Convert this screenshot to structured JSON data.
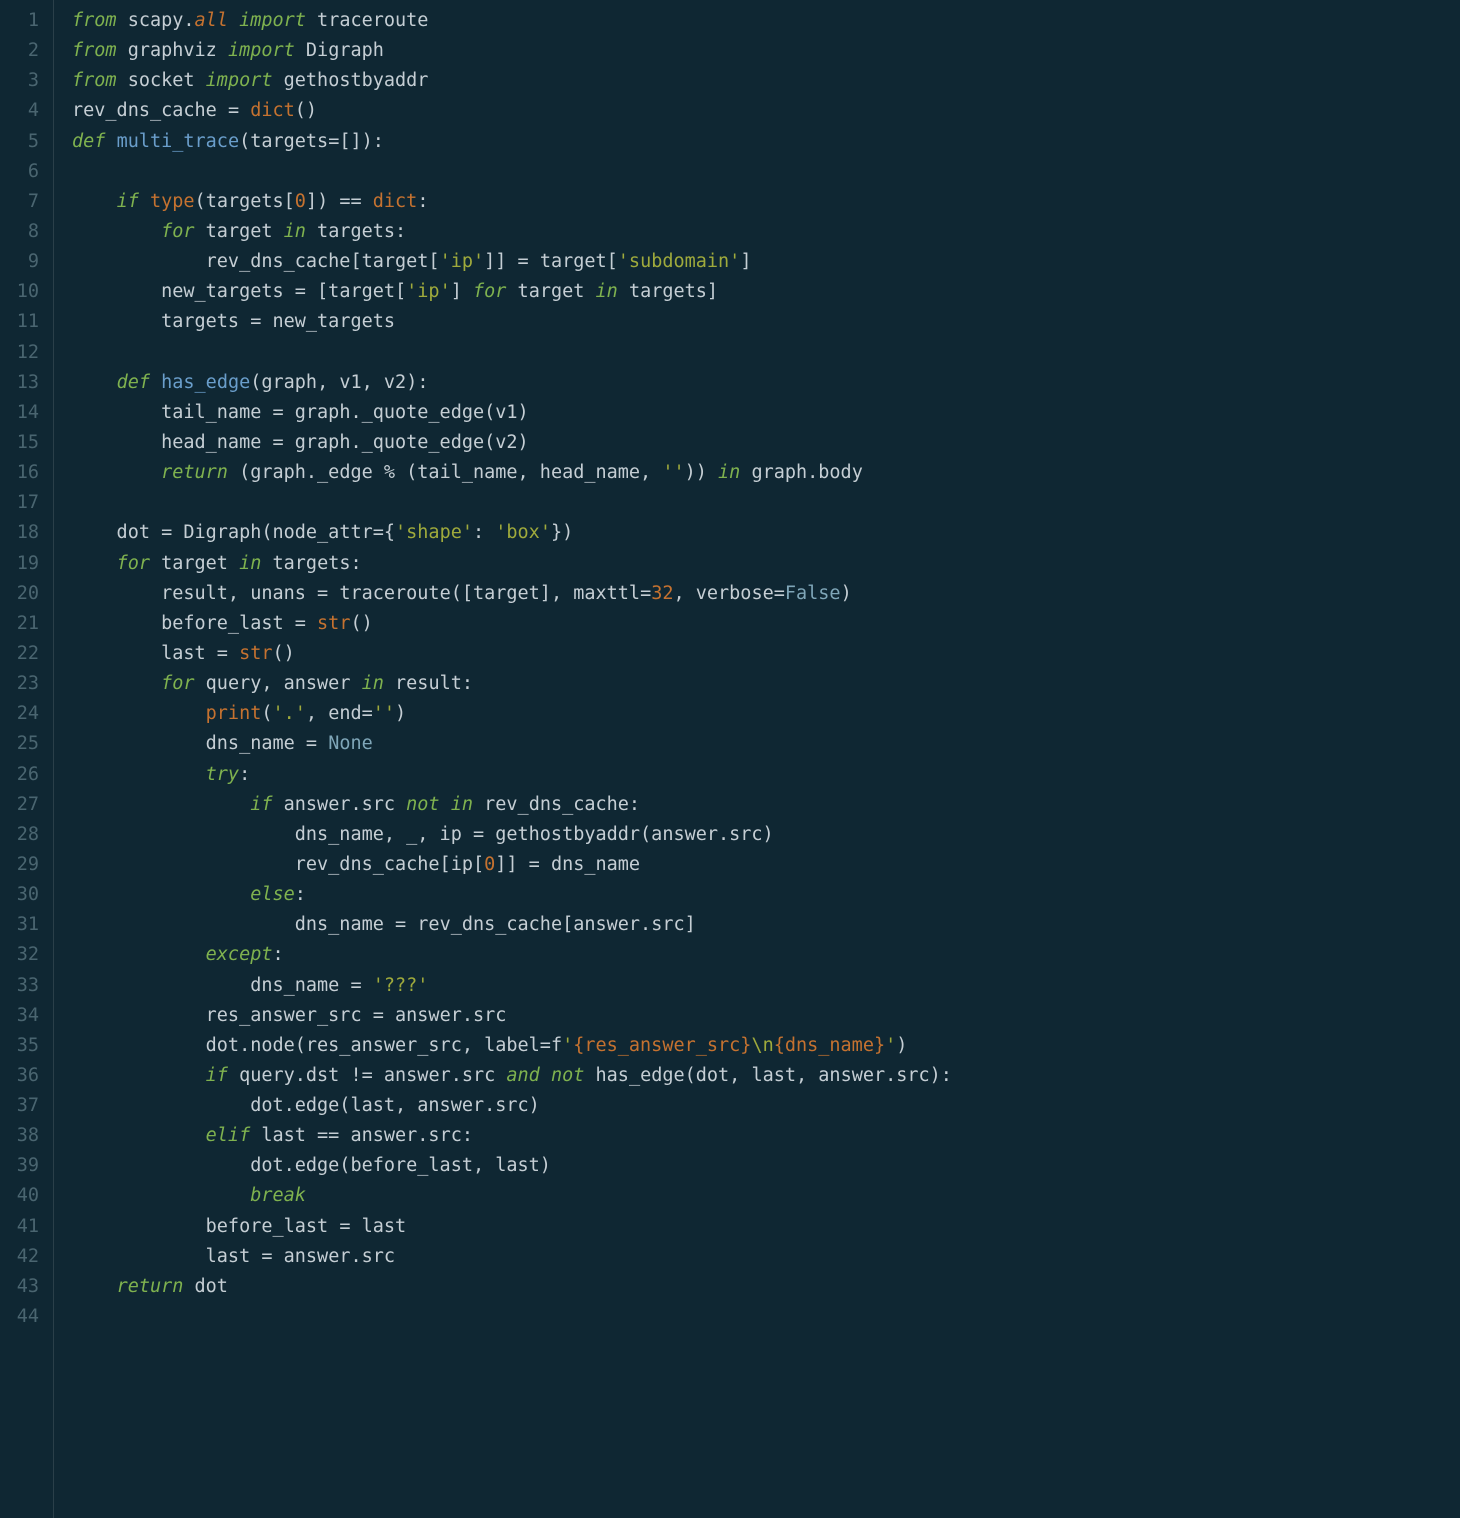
{
  "lineCount": 44,
  "code": {
    "l1": [
      [
        "kw",
        "from"
      ],
      [
        "id",
        " scapy"
      ],
      [
        "op",
        "."
      ],
      [
        "kw2",
        "all"
      ],
      [
        "id",
        " "
      ],
      [
        "kw",
        "import"
      ],
      [
        "id",
        " traceroute"
      ]
    ],
    "l2": [
      [
        "kw",
        "from"
      ],
      [
        "id",
        " graphviz "
      ],
      [
        "kw",
        "import"
      ],
      [
        "id",
        " Digraph"
      ]
    ],
    "l3": [
      [
        "kw",
        "from"
      ],
      [
        "id",
        " socket "
      ],
      [
        "kw",
        "import"
      ],
      [
        "id",
        " gethostbyaddr"
      ]
    ],
    "l4": [
      [
        "id",
        "rev_dns_cache "
      ],
      [
        "op",
        "="
      ],
      [
        "id",
        " "
      ],
      [
        "bi",
        "dict"
      ],
      [
        "op",
        "()"
      ]
    ],
    "l5": [
      [
        "kw",
        "def"
      ],
      [
        "id",
        " "
      ],
      [
        "def",
        "multi_trace"
      ],
      [
        "op",
        "("
      ],
      [
        "id",
        "targets"
      ],
      [
        "op",
        "=[]):"
      ]
    ],
    "l6": [],
    "l7": [
      [
        "id",
        "    "
      ],
      [
        "kw",
        "if"
      ],
      [
        "id",
        " "
      ],
      [
        "bi",
        "type"
      ],
      [
        "op",
        "("
      ],
      [
        "id",
        "targets"
      ],
      [
        "op",
        "["
      ],
      [
        "num",
        "0"
      ],
      [
        "op",
        "]) == "
      ],
      [
        "bi",
        "dict"
      ],
      [
        "op",
        ":"
      ]
    ],
    "l8": [
      [
        "id",
        "        "
      ],
      [
        "kw",
        "for"
      ],
      [
        "id",
        " target "
      ],
      [
        "kw",
        "in"
      ],
      [
        "id",
        " targets:"
      ]
    ],
    "l9": [
      [
        "id",
        "            rev_dns_cache[target["
      ],
      [
        "str",
        "'ip'"
      ],
      [
        "id",
        "]] "
      ],
      [
        "op",
        "="
      ],
      [
        "id",
        " target["
      ],
      [
        "str",
        "'subdomain'"
      ],
      [
        "id",
        "]"
      ]
    ],
    "l10": [
      [
        "id",
        "        new_targets "
      ],
      [
        "op",
        "="
      ],
      [
        "id",
        " [target["
      ],
      [
        "str",
        "'ip'"
      ],
      [
        "id",
        "] "
      ],
      [
        "kw",
        "for"
      ],
      [
        "id",
        " target "
      ],
      [
        "kw",
        "in"
      ],
      [
        "id",
        " targets]"
      ]
    ],
    "l11": [
      [
        "id",
        "        targets "
      ],
      [
        "op",
        "="
      ],
      [
        "id",
        " new_targets"
      ]
    ],
    "l12": [],
    "l13": [
      [
        "id",
        "    "
      ],
      [
        "kw",
        "def"
      ],
      [
        "id",
        " "
      ],
      [
        "def",
        "has_edge"
      ],
      [
        "op",
        "("
      ],
      [
        "id",
        "graph"
      ],
      [
        "op",
        ", "
      ],
      [
        "id",
        "v1"
      ],
      [
        "op",
        ", "
      ],
      [
        "id",
        "v2"
      ],
      [
        "op",
        "):"
      ]
    ],
    "l14": [
      [
        "id",
        "        tail_name "
      ],
      [
        "op",
        "="
      ],
      [
        "id",
        " graph._quote_edge(v1)"
      ]
    ],
    "l15": [
      [
        "id",
        "        head_name "
      ],
      [
        "op",
        "="
      ],
      [
        "id",
        " graph._quote_edge(v2)"
      ]
    ],
    "l16": [
      [
        "id",
        "        "
      ],
      [
        "kw",
        "return"
      ],
      [
        "id",
        " (graph._edge "
      ],
      [
        "op",
        "%"
      ],
      [
        "id",
        " (tail_name, head_name, "
      ],
      [
        "str",
        "''"
      ],
      [
        "id",
        ")) "
      ],
      [
        "kw",
        "in"
      ],
      [
        "id",
        " graph.body"
      ]
    ],
    "l17": [],
    "l18": [
      [
        "id",
        "    dot "
      ],
      [
        "op",
        "="
      ],
      [
        "id",
        " Digraph(node_attr"
      ],
      [
        "op",
        "="
      ],
      [
        "id",
        "{"
      ],
      [
        "str",
        "'shape'"
      ],
      [
        "op",
        ": "
      ],
      [
        "str",
        "'box'"
      ],
      [
        "id",
        "})"
      ]
    ],
    "l19": [
      [
        "id",
        "    "
      ],
      [
        "kw",
        "for"
      ],
      [
        "id",
        " target "
      ],
      [
        "kw",
        "in"
      ],
      [
        "id",
        " targets:"
      ]
    ],
    "l20": [
      [
        "id",
        "        result, unans "
      ],
      [
        "op",
        "="
      ],
      [
        "id",
        " traceroute([target], maxttl"
      ],
      [
        "op",
        "="
      ],
      [
        "num",
        "32"
      ],
      [
        "id",
        ", verbose"
      ],
      [
        "op",
        "="
      ],
      [
        "c1",
        "False"
      ],
      [
        "id",
        ")"
      ]
    ],
    "l21": [
      [
        "id",
        "        before_last "
      ],
      [
        "op",
        "="
      ],
      [
        "id",
        " "
      ],
      [
        "bi",
        "str"
      ],
      [
        "op",
        "()"
      ]
    ],
    "l22": [
      [
        "id",
        "        last "
      ],
      [
        "op",
        "="
      ],
      [
        "id",
        " "
      ],
      [
        "bi",
        "str"
      ],
      [
        "op",
        "()"
      ]
    ],
    "l23": [
      [
        "id",
        "        "
      ],
      [
        "kw",
        "for"
      ],
      [
        "id",
        " query, answer "
      ],
      [
        "kw",
        "in"
      ],
      [
        "id",
        " result:"
      ]
    ],
    "l24": [
      [
        "id",
        "            "
      ],
      [
        "bi",
        "print"
      ],
      [
        "op",
        "("
      ],
      [
        "str",
        "'.'"
      ],
      [
        "op",
        ", "
      ],
      [
        "id",
        "end"
      ],
      [
        "op",
        "="
      ],
      [
        "str",
        "''"
      ],
      [
        "op",
        ")"
      ]
    ],
    "l25": [
      [
        "id",
        "            dns_name "
      ],
      [
        "op",
        "="
      ],
      [
        "id",
        " "
      ],
      [
        "c1",
        "None"
      ]
    ],
    "l26": [
      [
        "id",
        "            "
      ],
      [
        "kw",
        "try"
      ],
      [
        "op",
        ":"
      ]
    ],
    "l27": [
      [
        "id",
        "                "
      ],
      [
        "kw",
        "if"
      ],
      [
        "id",
        " answer.src "
      ],
      [
        "kw",
        "not"
      ],
      [
        "id",
        " "
      ],
      [
        "kw",
        "in"
      ],
      [
        "id",
        " rev_dns_cache:"
      ]
    ],
    "l28": [
      [
        "id",
        "                    dns_name, _, ip "
      ],
      [
        "op",
        "="
      ],
      [
        "id",
        " gethostbyaddr(answer.src)"
      ]
    ],
    "l29": [
      [
        "id",
        "                    rev_dns_cache[ip["
      ],
      [
        "num",
        "0"
      ],
      [
        "id",
        "]] "
      ],
      [
        "op",
        "="
      ],
      [
        "id",
        " dns_name"
      ]
    ],
    "l30": [
      [
        "id",
        "                "
      ],
      [
        "kw",
        "else"
      ],
      [
        "op",
        ":"
      ]
    ],
    "l31": [
      [
        "id",
        "                    dns_name "
      ],
      [
        "op",
        "="
      ],
      [
        "id",
        " rev_dns_cache[answer.src]"
      ]
    ],
    "l32": [
      [
        "id",
        "            "
      ],
      [
        "kw",
        "except"
      ],
      [
        "op",
        ":"
      ]
    ],
    "l33": [
      [
        "id",
        "                dns_name "
      ],
      [
        "op",
        "="
      ],
      [
        "id",
        " "
      ],
      [
        "str",
        "'???'"
      ]
    ],
    "l34": [
      [
        "id",
        "            res_answer_src "
      ],
      [
        "op",
        "="
      ],
      [
        "id",
        " answer.src"
      ]
    ],
    "l35": [
      [
        "id",
        "            dot.node(res_answer_src, label"
      ],
      [
        "op",
        "="
      ],
      [
        "id",
        "f"
      ],
      [
        "str",
        "'"
      ],
      [
        "fst",
        "{res_answer_src}"
      ],
      [
        "str",
        "\\n"
      ],
      [
        "fst",
        "{dns_name}"
      ],
      [
        "str",
        "'"
      ],
      [
        "id",
        ")"
      ]
    ],
    "l36": [
      [
        "id",
        "            "
      ],
      [
        "kw",
        "if"
      ],
      [
        "id",
        " query.dst "
      ],
      [
        "op",
        "!="
      ],
      [
        "id",
        " answer.src "
      ],
      [
        "kw",
        "and"
      ],
      [
        "id",
        " "
      ],
      [
        "kw",
        "not"
      ],
      [
        "id",
        " has_edge(dot, last, answer.src):"
      ]
    ],
    "l37": [
      [
        "id",
        "                dot.edge(last, answer.src)"
      ]
    ],
    "l38": [
      [
        "id",
        "            "
      ],
      [
        "kw",
        "elif"
      ],
      [
        "id",
        " last "
      ],
      [
        "op",
        "=="
      ],
      [
        "id",
        " answer.src:"
      ]
    ],
    "l39": [
      [
        "id",
        "                dot.edge(before_last, last)"
      ]
    ],
    "l40": [
      [
        "id",
        "                "
      ],
      [
        "kw",
        "break"
      ]
    ],
    "l41": [
      [
        "id",
        "            before_last "
      ],
      [
        "op",
        "="
      ],
      [
        "id",
        " last"
      ]
    ],
    "l42": [
      [
        "id",
        "            last "
      ],
      [
        "op",
        "="
      ],
      [
        "id",
        " answer.src"
      ]
    ],
    "l43": [
      [
        "id",
        "    "
      ],
      [
        "kw",
        "return"
      ],
      [
        "id",
        " dot"
      ]
    ],
    "l44": []
  }
}
